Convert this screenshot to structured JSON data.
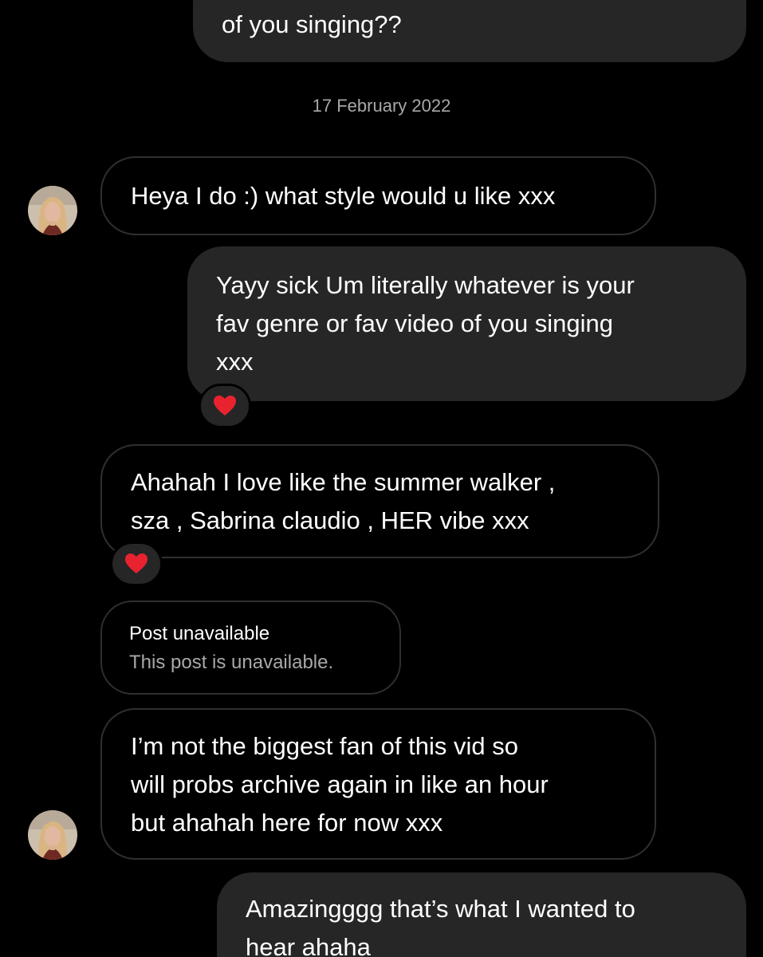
{
  "conversation": {
    "date_separator": "17 February 2022",
    "messages": [
      {
        "id": "m1",
        "direction": "sent",
        "lines": [
          "of you singing??"
        ]
      },
      {
        "id": "m2",
        "direction": "received",
        "lines": [
          "Heya I do :) what style would u like xxx"
        ]
      },
      {
        "id": "m3",
        "direction": "sent",
        "lines": [
          "Yayy sick Um literally whatever is your",
          "fav genre or fav video of you singing",
          "xxx"
        ],
        "reaction": "❤️"
      },
      {
        "id": "m4",
        "direction": "received",
        "lines": [
          "Ahahah I love like the summer walker ,",
          "sza , Sabrina claudio , HER vibe xxx"
        ],
        "reaction": "❤️"
      },
      {
        "id": "m5",
        "direction": "received",
        "type": "post",
        "title": "Post unavailable",
        "subtitle": "This post is unavailable."
      },
      {
        "id": "m6",
        "direction": "received",
        "lines": [
          "I’m not the biggest fan of this vid so",
          "will probs archive again in like an hour",
          "but ahahah here for now xxx"
        ]
      },
      {
        "id": "m7",
        "direction": "sent",
        "lines": [
          "Amazingggg that’s what I wanted to",
          "hear ahaha"
        ]
      }
    ]
  },
  "colors": {
    "background": "#000000",
    "sent_bubble": "#262626",
    "received_border": "#2f2f2f",
    "muted_text": "#a8a8a8",
    "heart": "#e8232f"
  },
  "icons": {
    "reaction": "heart-icon",
    "avatar": "contact-avatar"
  }
}
